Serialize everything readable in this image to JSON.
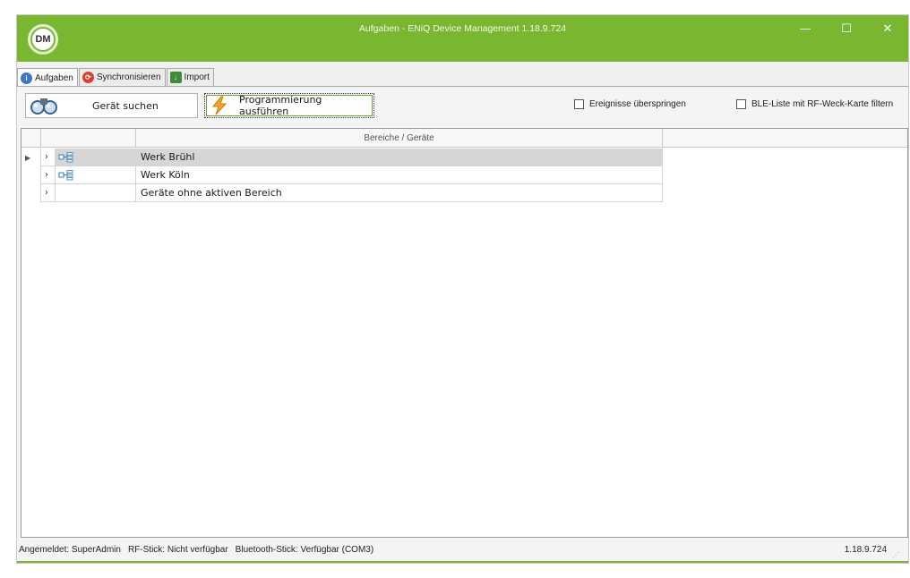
{
  "window": {
    "title": "Aufgaben - ENiQ Device Management 1.18.9.724",
    "logo_text": "DM",
    "minimize_glyph": "—",
    "maximize_glyph": "☐",
    "close_glyph": "✕"
  },
  "tabs": [
    {
      "label": "Aufgaben",
      "icon": "info-icon",
      "active": true
    },
    {
      "label": "Synchronisieren",
      "icon": "sync-icon",
      "active": false
    },
    {
      "label": "Import",
      "icon": "import-icon",
      "active": false
    }
  ],
  "toolbar": {
    "search_label": "Gerät suchen",
    "program_label": "Programmierung ausführen",
    "skip_events_label": "Ereignisse überspringen",
    "ble_filter_label": "BLE-Liste mit RF-Weck-Karte filtern"
  },
  "grid": {
    "column_header": "Bereiche / Geräte",
    "rows": [
      {
        "name": "Werk Brühl",
        "has_icon": true,
        "selected": true
      },
      {
        "name": "Werk Köln",
        "has_icon": true,
        "selected": false
      },
      {
        "name": "Geräte ohne aktiven Bereich",
        "has_icon": false,
        "selected": false
      }
    ]
  },
  "status": {
    "logged_in": "Angemeldet: SuperAdmin",
    "rf_stick": "RF-Stick: Nicht verfügbar",
    "bluetooth_stick": "Bluetooth-Stick: Verfügbar (COM3)",
    "version": "1.18.9.724"
  },
  "colors": {
    "accent": "#7ab730"
  }
}
